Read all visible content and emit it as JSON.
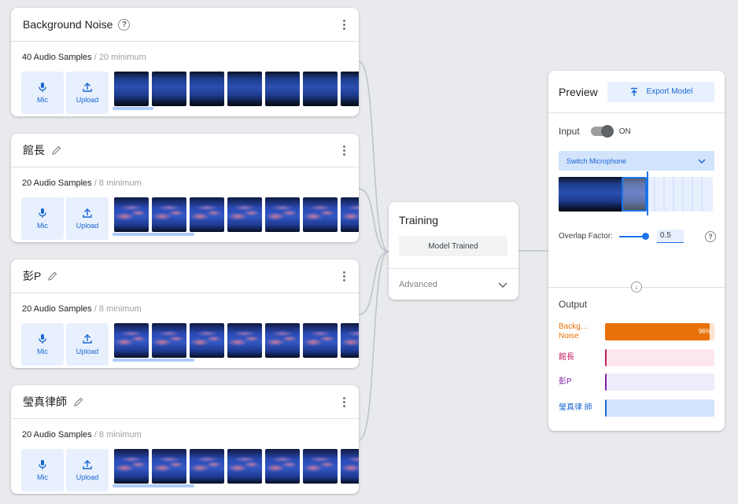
{
  "classes": [
    {
      "title": "Background Noise",
      "count": "40 Audio Samples",
      "minimum": " / 20 minimum",
      "has_help": true,
      "spec_style": "noise"
    },
    {
      "title": "館長",
      "count": "20 Audio Samples",
      "minimum": " / 8 minimum",
      "has_help": false,
      "spec_style": "voice"
    },
    {
      "title": "彭P",
      "count": "20 Audio Samples",
      "minimum": " / 8 minimum",
      "has_help": false,
      "spec_style": "voice"
    },
    {
      "title": "瑩真律師",
      "count": "20 Audio Samples",
      "minimum": " / 8 minimum",
      "has_help": false,
      "spec_style": "voice"
    }
  ],
  "buttons": {
    "mic": "Mic",
    "upload": "Upload"
  },
  "training": {
    "title": "Training",
    "status_button": "Model Trained",
    "advanced": "Advanced"
  },
  "preview": {
    "title": "Preview",
    "export_label": "Export Model",
    "input_label": "Input",
    "toggle_state": "ON",
    "switch_mic_label": "Switch Microphone",
    "overlap_label": "Overlap Factor:",
    "overlap_value": "0.5",
    "overlap_slider": 1.0,
    "output_label": "Output",
    "outputs": [
      {
        "label": "Backg… Noise",
        "pct_text": "96%",
        "confidence": 0.96,
        "color": "#e8710a",
        "bg": "#fde3cc",
        "label_color": "#e8710a"
      },
      {
        "label": "館長",
        "pct_text": "",
        "confidence": 0.01,
        "color": "#c2185b",
        "bg": "#fce8ec",
        "label_color": "#c2185b"
      },
      {
        "label": "彭P",
        "pct_text": "",
        "confidence": 0.01,
        "color": "#7b1fa2",
        "bg": "#f0ebfb",
        "label_color": "#7b1fa2"
      },
      {
        "label": "瑩真律 師",
        "pct_text": "",
        "confidence": 0.01,
        "color": "#1967d2",
        "bg": "#d2e3fc",
        "label_color": "#1967d2"
      }
    ]
  }
}
